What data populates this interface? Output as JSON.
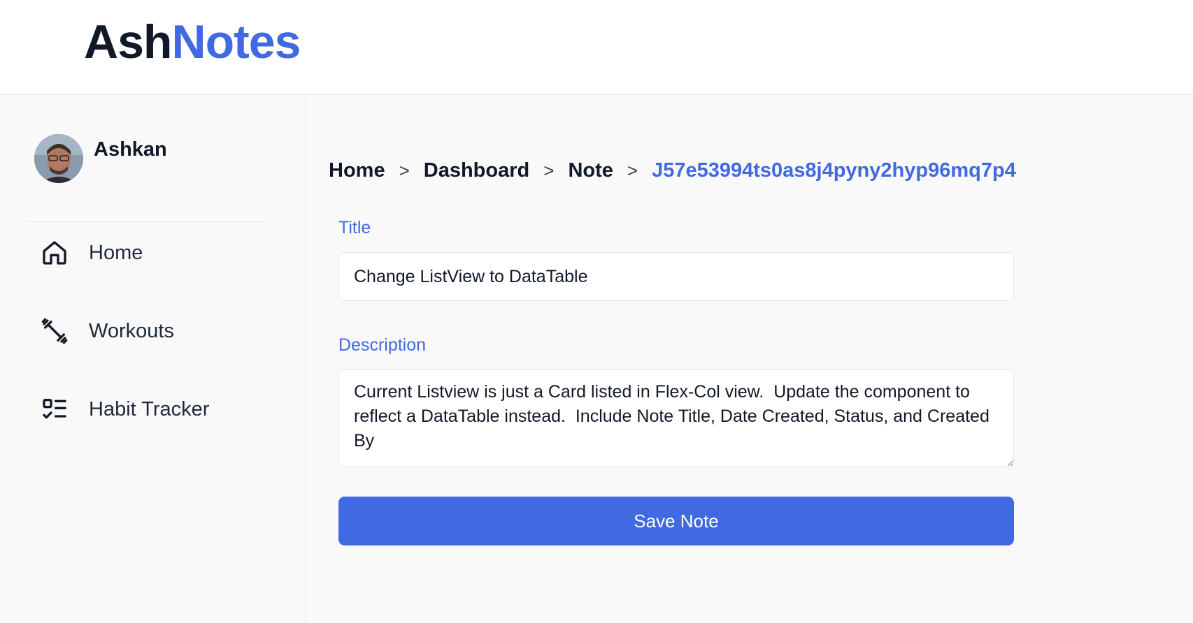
{
  "app": {
    "logo_part1": "Ash",
    "logo_part2": "Notes",
    "accent_color": "#4169e1"
  },
  "sidebar": {
    "user_name": "Ashkan",
    "items": [
      {
        "label": "Home",
        "icon": "home-icon"
      },
      {
        "label": "Workouts",
        "icon": "dumbbell-icon"
      },
      {
        "label": "Habit Tracker",
        "icon": "checklist-icon"
      }
    ]
  },
  "breadcrumb": {
    "items": [
      "Home",
      "Dashboard",
      "Note"
    ],
    "current": "J57e53994ts0as8j4pyny2hyp96mq7p4",
    "separator": ">"
  },
  "form": {
    "title_label": "Title",
    "title_value": "Change ListView to DataTable",
    "description_label": "Description",
    "description_value": "Current Listview is just a Card listed in Flex-Col view.  Update the component to reflect a DataTable instead.  Include Note Title, Date Created, Status, and Created By",
    "save_label": "Save Note"
  }
}
